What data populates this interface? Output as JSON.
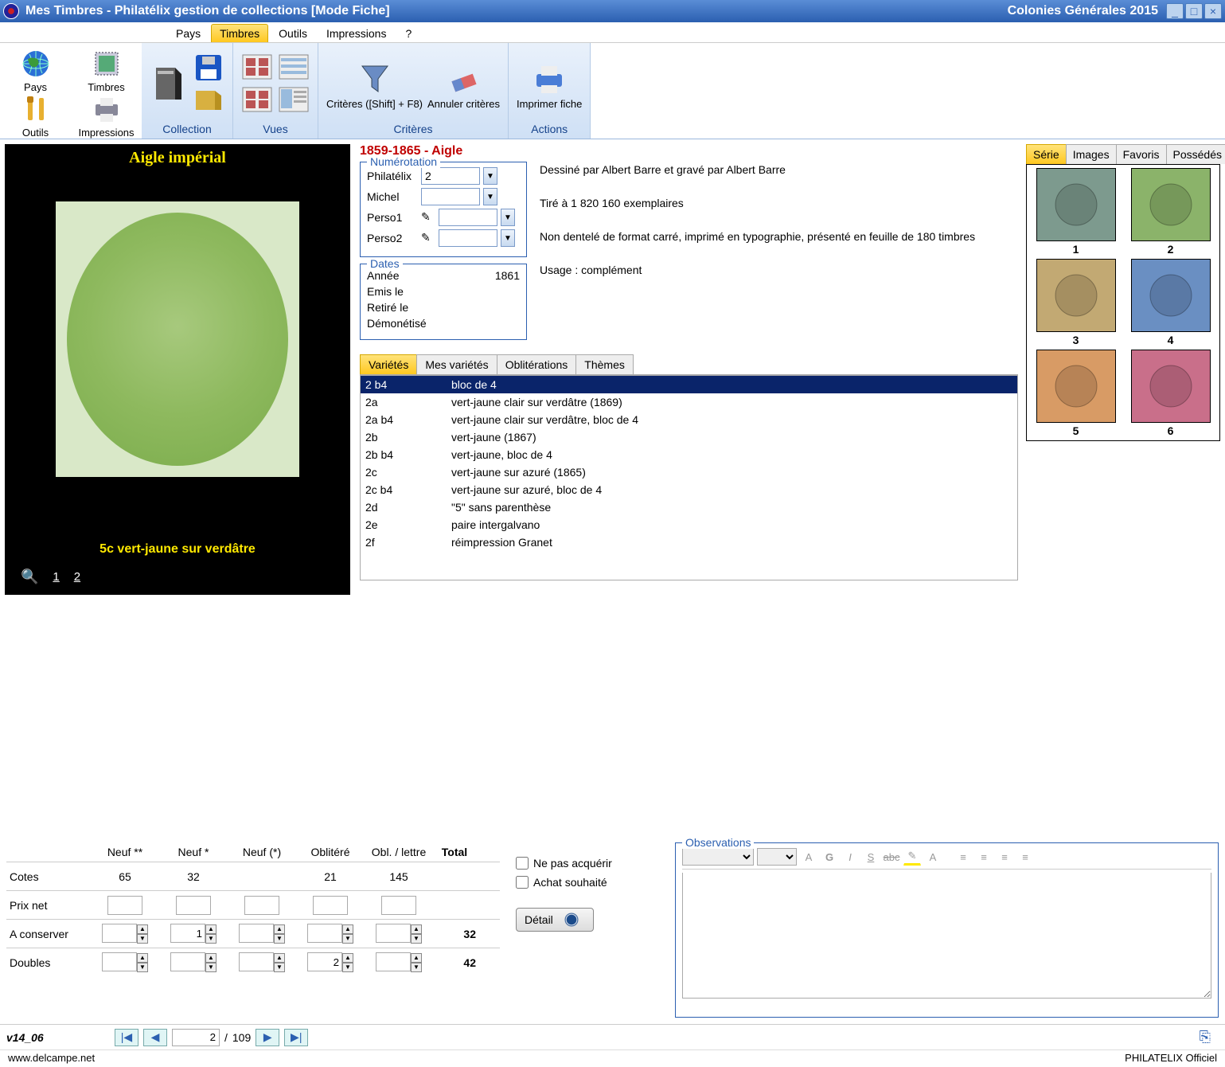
{
  "titlebar": {
    "left": "Mes Timbres - Philatélix gestion de collections [Mode Fiche]",
    "right": "Colonies Générales 2015"
  },
  "menu": {
    "items": [
      "Pays",
      "Timbres",
      "Outils",
      "Impressions",
      "?"
    ],
    "active": 1
  },
  "left_ribbon": [
    {
      "label": "Pays"
    },
    {
      "label": "Timbres"
    },
    {
      "label": "Outils"
    },
    {
      "label": "Impressions"
    }
  ],
  "ribbon": {
    "groups": [
      {
        "label": "Collection"
      },
      {
        "label": "Vues"
      },
      {
        "label": "Critères",
        "items": [
          {
            "label": "Critères ([Shift] + F8)"
          },
          {
            "label": "Annuler critères"
          }
        ]
      },
      {
        "label": "Actions",
        "items": [
          {
            "label": "Imprimer fiche"
          }
        ]
      }
    ]
  },
  "stamp": {
    "title": "Aigle impérial",
    "caption": "5c vert-jaune sur verdâtre",
    "pages": [
      "1",
      "2"
    ]
  },
  "series": {
    "header": "1859-1865 - Aigle"
  },
  "numerotation": {
    "legend": "Numérotation",
    "rows": [
      {
        "label": "Philatélix",
        "value": "2"
      },
      {
        "label": "Michel",
        "value": ""
      },
      {
        "label": "Perso1",
        "value": ""
      },
      {
        "label": "Perso2",
        "value": ""
      }
    ]
  },
  "dates": {
    "legend": "Dates",
    "rows": [
      {
        "label": "Année",
        "value": "1861"
      },
      {
        "label": "Emis le",
        "value": ""
      },
      {
        "label": "Retiré le",
        "value": ""
      },
      {
        "label": "Démonétisé",
        "value": ""
      }
    ]
  },
  "description": {
    "line1": "Dessiné par Albert Barre et gravé par Albert Barre",
    "line2": "Tiré à 1 820 160 exemplaires",
    "line3": "Non dentelé de format carré, imprimé en typographie, présenté en feuille de 180 timbres",
    "line4": "Usage : complément"
  },
  "subtabs": {
    "items": [
      "Variétés",
      "Mes variétés",
      "Oblitérations",
      "Thèmes"
    ],
    "active": 0
  },
  "varieties": [
    {
      "code": "2 b4",
      "desc": "bloc de 4",
      "sel": true
    },
    {
      "code": "2a",
      "desc": "vert-jaune clair sur verdâtre (1869)"
    },
    {
      "code": "2a b4",
      "desc": "vert-jaune clair sur verdâtre, bloc de 4"
    },
    {
      "code": "2b",
      "desc": "vert-jaune (1867)"
    },
    {
      "code": "2b b4",
      "desc": "vert-jaune, bloc de 4"
    },
    {
      "code": "2c",
      "desc": "vert-jaune sur azuré (1865)"
    },
    {
      "code": "2c b4",
      "desc": "vert-jaune sur azuré, bloc de 4"
    },
    {
      "code": "2d",
      "desc": "\"5\" sans parenthèse"
    },
    {
      "code": "2e",
      "desc": "paire intergalvano"
    },
    {
      "code": "2f",
      "desc": "réimpression Granet"
    }
  ],
  "rtabs": {
    "items": [
      "Série",
      "Images",
      "Favoris",
      "Possédés"
    ],
    "active": 0
  },
  "thumbs": [
    {
      "n": "1",
      "bg": "#7d9a8e"
    },
    {
      "n": "2",
      "bg": "#8bb36a"
    },
    {
      "n": "3",
      "bg": "#c2a973"
    },
    {
      "n": "4",
      "bg": "#6a8fc2"
    },
    {
      "n": "5",
      "bg": "#d89b65"
    },
    {
      "n": "6",
      "bg": "#c96f8a"
    }
  ],
  "values": {
    "headers": [
      "Neuf **",
      "Neuf *",
      "Neuf (*)",
      "Oblitéré",
      "Obl. / lettre",
      "Total"
    ],
    "rows": [
      {
        "label": "Cotes",
        "c": [
          "65",
          "32",
          "",
          "21",
          "145"
        ],
        "total": ""
      },
      {
        "label": "Prix net",
        "c": [
          "",
          "",
          "",
          "",
          ""
        ],
        "total": ""
      },
      {
        "label": "A conserver",
        "c": [
          "",
          "1",
          "",
          "",
          ""
        ],
        "total": "32"
      },
      {
        "label": "Doubles",
        "c": [
          "",
          "",
          "",
          "2",
          ""
        ],
        "total": "42"
      }
    ]
  },
  "checks": {
    "c1": "Ne pas acquérir",
    "c2": "Achat souhaité",
    "detail": "Détail"
  },
  "observations": {
    "legend": "Observations"
  },
  "nav": {
    "version": "v14_06",
    "current": "2",
    "sep": "/",
    "total": "109"
  },
  "footer": {
    "left": "www.delcampe.net",
    "right": "PHILATELIX Officiel"
  }
}
